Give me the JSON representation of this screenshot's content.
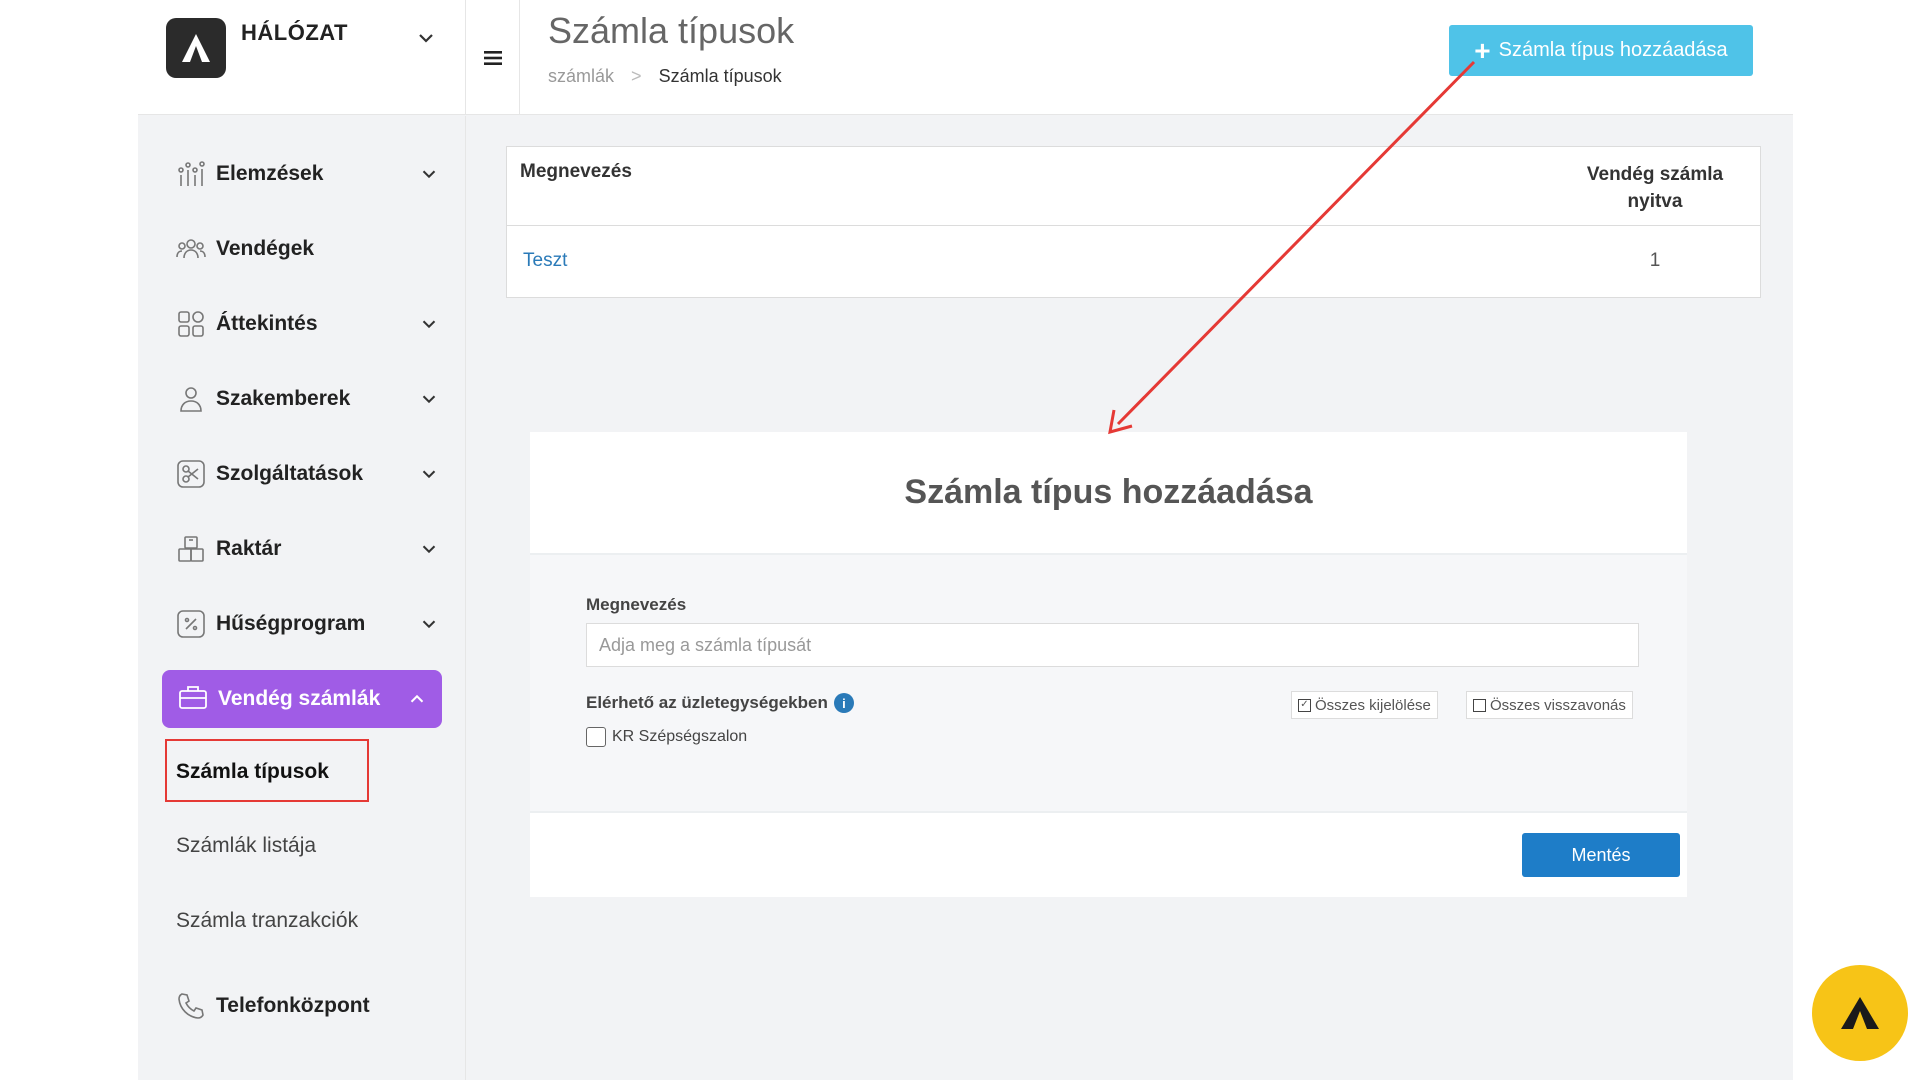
{
  "brand": {
    "name": "HÁLÓZAT"
  },
  "header": {
    "title": "Számla típusok",
    "breadcrumb": [
      "számlák",
      "Számla típusok"
    ],
    "breadcrumb_sep": ">",
    "add_button": "Számla típus hozzáadása"
  },
  "sidebar": {
    "items": [
      {
        "label": "Elemzések",
        "icon": "analytics-icon",
        "has_chevron": true
      },
      {
        "label": "Vendégek",
        "icon": "guests-icon",
        "has_chevron": false
      },
      {
        "label": "Áttekintés",
        "icon": "grid-icon",
        "has_chevron": true
      },
      {
        "label": "Szakemberek",
        "icon": "person-icon",
        "has_chevron": true
      },
      {
        "label": "Szolgáltatások",
        "icon": "scissors-icon",
        "has_chevron": true
      },
      {
        "label": "Raktár",
        "icon": "boxes-icon",
        "has_chevron": true
      },
      {
        "label": "Hűségprogram",
        "icon": "percent-icon",
        "has_chevron": true
      }
    ],
    "active": {
      "label": "Vendég számlák",
      "icon": "briefcase-icon"
    },
    "subitems": [
      "Számla típusok",
      "Számlák listája",
      "Számla tranzakciók"
    ],
    "bottom": {
      "label": "Telefonközpont",
      "icon": "phone-icon"
    }
  },
  "table": {
    "headers": [
      "Megnevezés",
      "Vendég számla nyitva"
    ],
    "rows": [
      {
        "name": "Teszt",
        "open": "1"
      }
    ]
  },
  "modal": {
    "title": "Számla típus hozzáadása",
    "name_label": "Megnevezés",
    "name_placeholder": "Adja meg a számla típusát",
    "available_label": "Elérhető az üzletegységekben",
    "info_glyph": "i",
    "select_all": "Összes kijelölése",
    "deselect_all": "Összes visszavonás",
    "shop": "KR Szépségszalon",
    "save": "Mentés"
  },
  "colors": {
    "accent_purple": "#a05ce6",
    "add_button": "#4fc3e8",
    "save_button": "#1e7dc8",
    "link": "#2a7ab8",
    "highlight_red": "#e53935",
    "fab_yellow": "#f7c417"
  }
}
